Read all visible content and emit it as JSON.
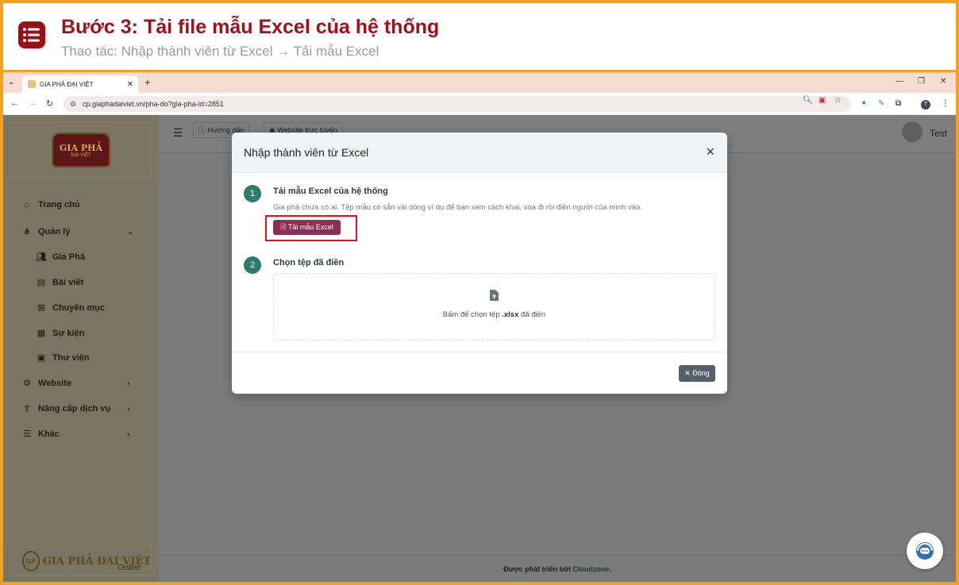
{
  "banner": {
    "title": "Bước 3: Tải file mẫu Excel của hệ thống",
    "subtitle": "Thao tác: Nhập thành viên từ Excel → Tải mẫu Excel",
    "icon": "list-icon"
  },
  "browser": {
    "tab_title": "GIA PHẢ ĐẠI VIỆT",
    "url": "cp.giaphadaiviet.vn/pha-do?gia-pha-id=2851",
    "profile_initial": "T"
  },
  "sidebar": {
    "logo_text": "GIA PHẢ",
    "logo_subtext": "ĐẠI VIỆT",
    "items": [
      {
        "label": "Trang chủ",
        "icon": "home-icon"
      },
      {
        "label": "Quản lý",
        "icon": "sitemap-icon",
        "expanded": true
      },
      {
        "label": "Gia Phả",
        "icon": "users-icon"
      },
      {
        "label": "Bài viết",
        "icon": "newspaper-icon"
      },
      {
        "label": "Chuyên mục",
        "icon": "grid-icon"
      },
      {
        "label": "Sự kiện",
        "icon": "calendar-icon"
      },
      {
        "label": "Thư viện",
        "icon": "images-icon"
      },
      {
        "label": "Website",
        "icon": "gear-icon"
      },
      {
        "label": "Nâng cấp dịch vụ",
        "icon": "upgrade-icon"
      },
      {
        "label": "Khác",
        "icon": "bars-icon"
      }
    ],
    "footer_brand": "GIA PHẢ ĐẠI VIỆT",
    "footer_gp": "GP",
    "footer_online": "Online"
  },
  "topbar": {
    "guide_label": "Hướng dẫn",
    "website_label": "Website trực tuyến",
    "user_name": "Test"
  },
  "footer": {
    "prefix": "Được phát triển bởi ",
    "brand": "Cloudzone",
    "suffix": "."
  },
  "modal": {
    "title": "Nhập thành viên từ Excel",
    "step1": {
      "number": "1",
      "title": "Tải mẫu Excel của hệ thống",
      "desc": "Gia phả chưa có ai. Tệp mẫu có sẵn vài dòng ví dụ để bạn xem cách khai, xoá đi rồi điền người của mình vào.",
      "button": "Tải mẫu Excel"
    },
    "step2": {
      "number": "2",
      "title": "Chọn tệp đã điền",
      "drop_prefix": "Bấm để chọn tệp ",
      "drop_ext": ".xlsx",
      "drop_suffix": " đã điền"
    },
    "close_button": "Đóng"
  },
  "colors": {
    "accent_red": "#a3101a",
    "teal": "#2d7d6c",
    "download_button": "#8c2f55",
    "highlight_border": "#e0141e",
    "frame_orange": "#f5a11f"
  }
}
